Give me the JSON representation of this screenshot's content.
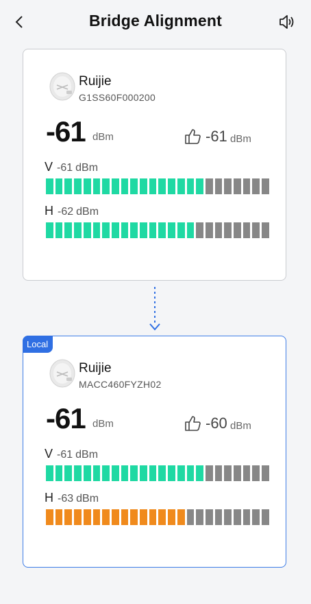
{
  "header": {
    "title": "Bridge Alignment"
  },
  "colors": {
    "good": "#1fd9a3",
    "weak": "#f08a1c",
    "off": "#878787",
    "accent": "#2f6fe3"
  },
  "segments_total": 24,
  "devices": [
    {
      "is_local": false,
      "name": "Ruijie",
      "serial": "G1SS60F000200",
      "rssi": "-61",
      "rssi_unit": "dBm",
      "peer_rssi": "-61",
      "peer_unit": "dBm",
      "axes": [
        {
          "label": "V",
          "value": "-61",
          "unit": "dBm",
          "filled": 17,
          "level": "good"
        },
        {
          "label": "H",
          "value": "-62",
          "unit": "dBm",
          "filled": 16,
          "level": "good"
        }
      ]
    },
    {
      "is_local": true,
      "badge": "Local",
      "name": "Ruijie",
      "serial": "MACC460FYZH02",
      "rssi": "-61",
      "rssi_unit": "dBm",
      "peer_rssi": "-60",
      "peer_unit": "dBm",
      "axes": [
        {
          "label": "V",
          "value": "-61",
          "unit": "dBm",
          "filled": 17,
          "level": "good"
        },
        {
          "label": "H",
          "value": "-63",
          "unit": "dBm",
          "filled": 15,
          "level": "weak"
        }
      ]
    }
  ]
}
